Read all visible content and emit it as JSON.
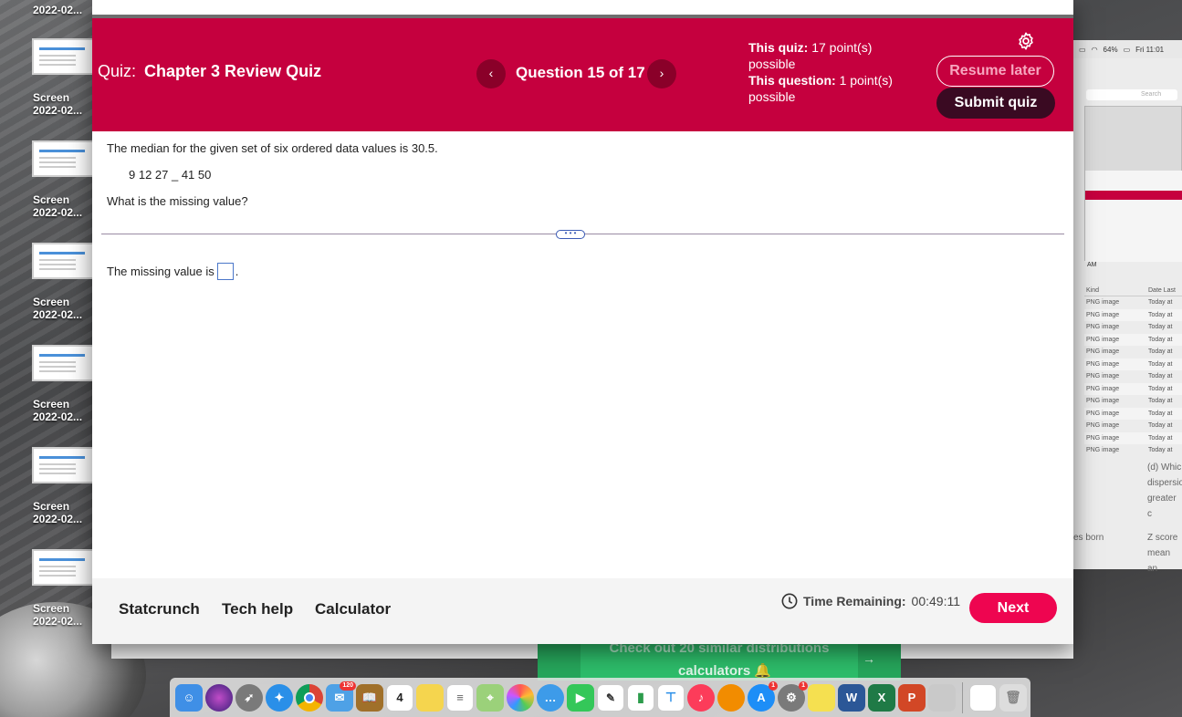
{
  "desktop": {
    "top_label": "2022-02...",
    "icons": [
      {
        "line1": "Screen",
        "line2": "2022-02..."
      },
      {
        "line1": "Screen",
        "line2": "2022-02..."
      },
      {
        "line1": "Screen",
        "line2": "2022-02..."
      },
      {
        "line1": "Screen",
        "line2": "2022-02..."
      },
      {
        "line1": "Screen",
        "line2": "2022-02..."
      },
      {
        "line1": "Screen",
        "line2": "2022-02..."
      }
    ]
  },
  "menubar": {
    "battery": "64%",
    "clock": "Fri 11:01"
  },
  "finder": {
    "search_placeholder": "Search",
    "preview_label": "AM",
    "columns": [
      "Kind",
      "Date Last"
    ],
    "rows": [
      {
        "kind": "PNG image",
        "date": "Today at"
      },
      {
        "kind": "PNG image",
        "date": "Today at"
      },
      {
        "kind": "PNG image",
        "date": "Today at"
      },
      {
        "kind": "PNG image",
        "date": "Today at"
      },
      {
        "kind": "PNG image",
        "date": "Today at"
      },
      {
        "kind": "PNG image",
        "date": "Today at"
      },
      {
        "kind": "PNG image",
        "date": "Today at"
      },
      {
        "kind": "PNG image",
        "date": "Today at"
      },
      {
        "kind": "PNG image",
        "date": "Today at"
      },
      {
        "kind": "PNG image",
        "date": "Today at"
      },
      {
        "kind": "PNG image",
        "date": "Today at"
      },
      {
        "kind": "PNG image",
        "date": "Today at"
      },
      {
        "kind": "PNG image",
        "date": "Today at"
      }
    ],
    "side_text_1": "(d) Whic",
    "side_text_2": "dispersio",
    "side_text_3": "greater c",
    "side_text_4": "es born",
    "side_text_5": "Z score",
    "side_text_6": "mean an"
  },
  "quiz": {
    "title_prefix": "Quiz:",
    "title": "Chapter 3 Review Quiz",
    "prev_icon": "‹",
    "next_icon": "›",
    "question_counter": "Question 15 of 17",
    "quiz_points_label": "This quiz:",
    "quiz_points": "17 point(s) possible",
    "question_points_label": "This question:",
    "question_points": "1 point(s) possible",
    "resume_label": "Resume later",
    "submit_label": "Submit quiz",
    "question_text": "The median for the given set of six ordered data values is 30.5.",
    "data_values": "9 12 27 _ 41 50",
    "prompt": "What is the missing value?",
    "divider_handle": "• • •",
    "answer_prefix": "The missing value is",
    "answer_suffix": ".",
    "answer_value": ""
  },
  "footer": {
    "links": [
      "Statcrunch",
      "Tech help",
      "Calculator"
    ],
    "time_label": "Time Remaining:",
    "time_value": "00:49:11",
    "next_label": "Next"
  },
  "ad": {
    "line1": "Check out 20 similar distributions",
    "line2": "calculators 🔔",
    "arrow": "→"
  },
  "dock": {
    "calendar_day": "4",
    "badges": {
      "mail": "120",
      "appstore": "1",
      "prefs": "1"
    },
    "colors": {
      "finder": "#3f8fe6",
      "siri": "#5b2c86",
      "launchpad": "#7a7a7a",
      "safari": "#2a8fe8",
      "chrome": "#ffffff",
      "mail": "#4ea1e6",
      "notes": "#f5d54e",
      "word": "#2b5797",
      "excel": "#1f7a46",
      "powerpoint": "#d24726"
    }
  }
}
